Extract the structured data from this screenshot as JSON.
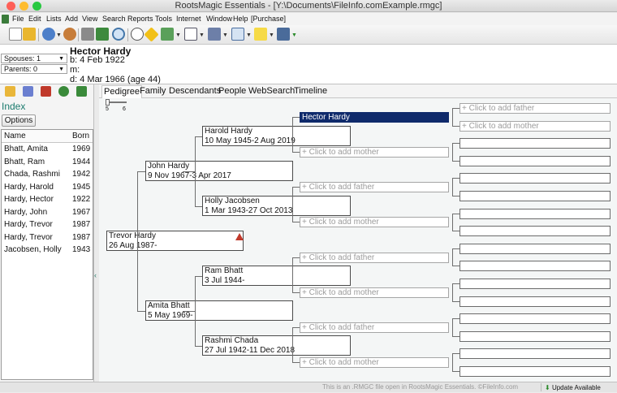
{
  "window": {
    "title": "RootsMagic Essentials - [Y:\\Documents\\FileInfo.comExample.rmgc]"
  },
  "menu": [
    "File",
    "Edit",
    "Lists",
    "Add",
    "View",
    "Search",
    "Reports",
    "Tools",
    "Internet",
    "Window",
    "Help",
    "[Purchase]"
  ],
  "header": {
    "spouses": "Spouses: 1",
    "parents": "Parents: 0",
    "name": "Hector Hardy",
    "birth": "b: 4 Feb 1922",
    "married": "m:",
    "death": "d: 4 Mar 1966 (age 44)"
  },
  "index": {
    "title": "Index",
    "options_label": "Options",
    "col_name": "Name",
    "col_born": "Born",
    "rows": [
      {
        "name": "Bhatt, Amita",
        "born": "1969"
      },
      {
        "name": "Bhatt, Ram",
        "born": "1944"
      },
      {
        "name": "Chada, Rashmi",
        "born": "1942"
      },
      {
        "name": "Hardy, Harold",
        "born": "1945"
      },
      {
        "name": "Hardy, Hector",
        "born": "1922"
      },
      {
        "name": "Hardy, John",
        "born": "1967"
      },
      {
        "name": "Hardy, Trevor",
        "born": "1987"
      },
      {
        "name": "Hardy, Trevor",
        "born": "1987"
      },
      {
        "name": "Jacobsen, Holly",
        "born": "1943"
      }
    ]
  },
  "tabs": [
    "Pedigree",
    "Family",
    "Descendants",
    "People",
    "WebSearch",
    "Timeline"
  ],
  "gen_slider": {
    "min": "5",
    "max": "6"
  },
  "pedigree": {
    "gen1": {
      "name": "Trevor Hardy",
      "dates": "26 Aug 1987-"
    },
    "gen2": [
      {
        "name": "John Hardy",
        "dates": "9 Nov 1967-3 Apr 2017"
      },
      {
        "name": "Amita Bhatt",
        "dates": "5 May 1969-"
      }
    ],
    "gen3": [
      {
        "name": "Harold Hardy",
        "dates": "10 May 1945-2 Aug 2019"
      },
      {
        "name": "Holly Jacobsen",
        "dates": "1 Mar 1943-27 Oct 2013"
      },
      {
        "name": "Ram Bhatt",
        "dates": "3 Jul 1944-"
      },
      {
        "name": "Rashmi Chada",
        "dates": "27 Jul 1942-11 Dec 2018"
      }
    ],
    "gen4": [
      "Hector Hardy",
      "+ Click to add mother",
      "+ Click to add father",
      "+ Click to add mother",
      "+ Click to add father",
      "+ Click to add mother",
      "+ Click to add father",
      "+ Click to add mother"
    ],
    "gen5": [
      "+ Click to add father",
      "+ Click to add mother",
      "",
      "",
      "",
      "",
      "",
      "",
      "",
      "",
      "",
      "",
      "",
      "",
      "",
      ""
    ]
  },
  "status": {
    "notice": "This is an .RMGC file open in RootsMagic Essentials. ©FileInfo.com",
    "update": "Update Available"
  },
  "colors": {
    "selected": "#0f2a6b",
    "accent": "#1a7a6d",
    "warning": "#c0392b"
  },
  "icons": [
    "traffic-lights",
    "app-icon",
    "toolbar-icons",
    "warning-icon",
    "update-icon"
  ]
}
